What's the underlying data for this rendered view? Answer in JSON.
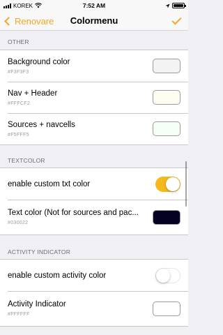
{
  "status_bar": {
    "carrier": "KOREK",
    "time": "7:52 AM",
    "battery_level": 1.0
  },
  "nav": {
    "back_label": "Renovare",
    "title": "Colormenu",
    "accent_color": "#f5a623"
  },
  "sections": {
    "other": {
      "header": "OTHER",
      "rows": [
        {
          "title": "Background color",
          "value": "#F3F3F3",
          "color": "#F3F3F3"
        },
        {
          "title": "Nav + Header",
          "value": "#FFFCF2",
          "color": "#FFFCF2"
        },
        {
          "title": "Sources + navcells",
          "value": "#F5FFF5",
          "color": "#F5FFF5"
        }
      ]
    },
    "textcolor": {
      "header": "TEXTCOLOR",
      "toggle": {
        "title": "enable custom txt color",
        "on": true
      },
      "color_row": {
        "title": "Text color (Not for sources and pac...",
        "value": "#030022",
        "color": "#030022"
      }
    },
    "activity": {
      "header": "ACTIVITY INDICATOR",
      "toggle": {
        "title": "enable custom activity color",
        "on": false
      },
      "color_row": {
        "title": "Activity Indicator",
        "value": "#FFFFFF",
        "color": "#FFFFFF"
      }
    }
  }
}
